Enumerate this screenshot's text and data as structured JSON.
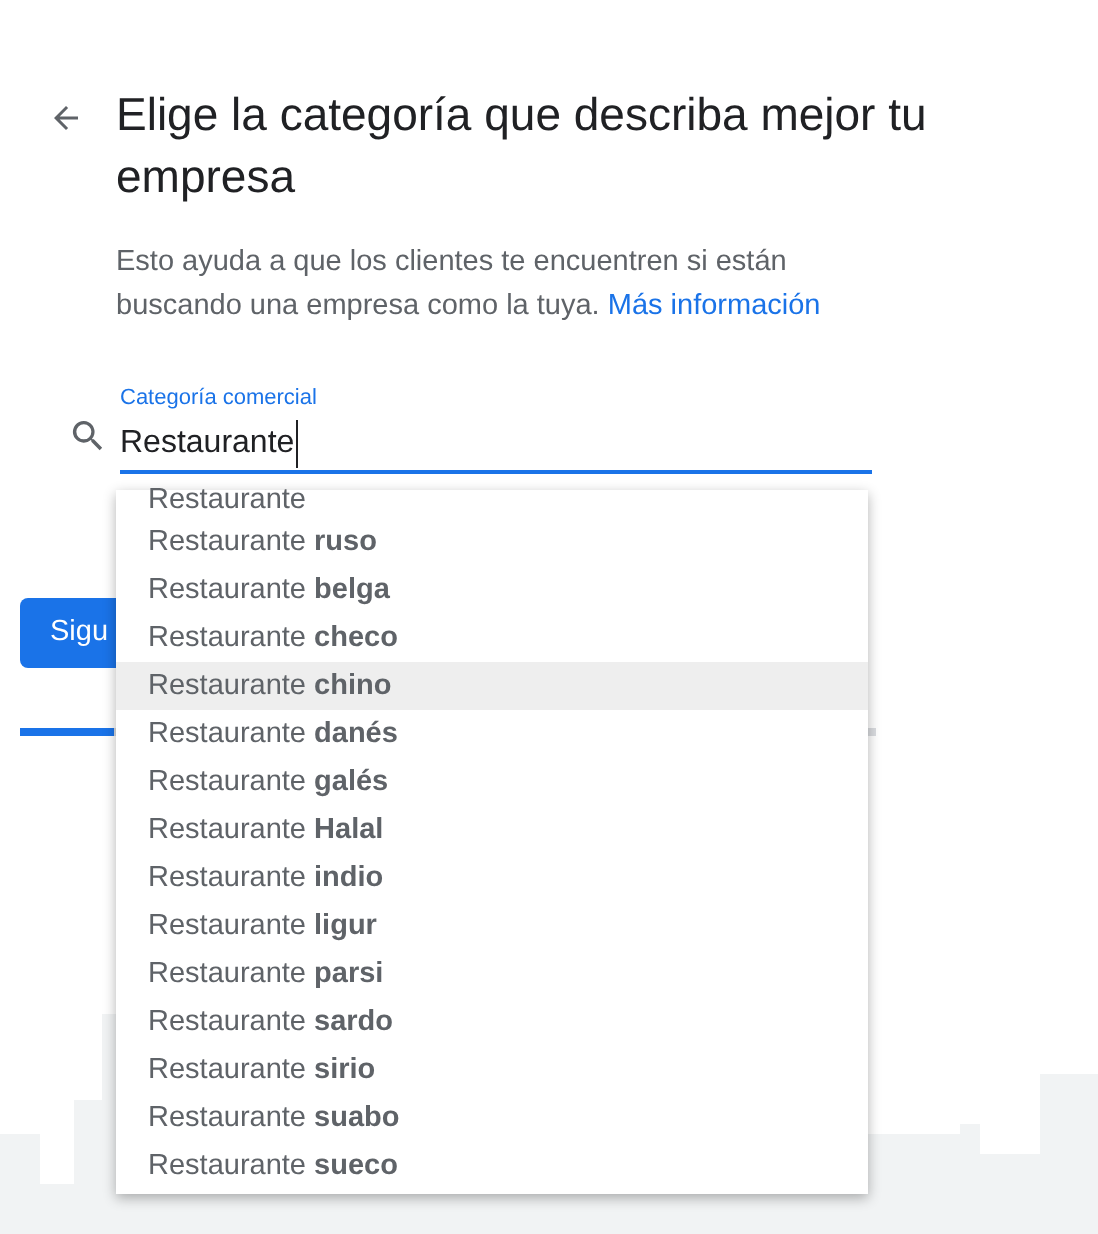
{
  "title": "Elige la categoría que describa mejor tu empresa",
  "description": {
    "text": "Esto ayuda a que los clientes te encuentren si están buscando una empresa como la tuya.",
    "link": "Más información"
  },
  "category_field": {
    "label": "Categoría comercial",
    "value": "Restaurante"
  },
  "suggestions": [
    {
      "text": "Restaurante",
      "selected": false
    },
    {
      "text": "Restaurante **ruso**",
      "selected": false
    },
    {
      "text": "Restaurante **belga**",
      "selected": false
    },
    {
      "text": "Restaurante **checo**",
      "selected": false
    },
    {
      "text": "Restaurante **chino**",
      "selected": true
    },
    {
      "text": "Restaurante **danés**",
      "selected": false
    },
    {
      "text": "Restaurante **galés**",
      "selected": false
    },
    {
      "text": "Restaurante **Halal**",
      "selected": false
    },
    {
      "text": "Restaurante **indio**",
      "selected": false
    },
    {
      "text": "Restaurante **ligur**",
      "selected": false
    },
    {
      "text": "Restaurante **parsi**",
      "selected": false
    },
    {
      "text": "Restaurante **sardo**",
      "selected": false
    },
    {
      "text": "Restaurante **sirio**",
      "selected": false
    },
    {
      "text": "Restaurante **suabo**",
      "selected": false
    },
    {
      "text": "Restaurante **sueco**",
      "selected": false
    }
  ],
  "next_button": "Sigu",
  "progress": {
    "level": 0.11
  }
}
